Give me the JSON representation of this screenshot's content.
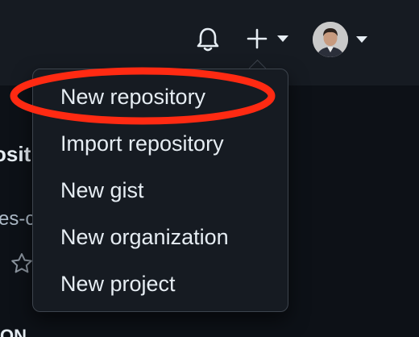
{
  "header": {
    "notifications_icon": "bell-icon",
    "create_icon": "plus-icon",
    "avatar_alt": "user avatar"
  },
  "background": {
    "repo_fragment": "osit",
    "desc_fragment": "es-c",
    "star_icon": "star-icon",
    "bottom_fragment": "ON"
  },
  "menu": {
    "items": [
      {
        "label": "New repository"
      },
      {
        "label": "Import repository"
      },
      {
        "label": "New gist"
      },
      {
        "label": "New organization"
      },
      {
        "label": "New project"
      }
    ]
  },
  "colors": {
    "header_bg": "#161b22",
    "page_bg": "#0d1117",
    "menu_bg": "#161b22",
    "text": "#e6edf3",
    "highlight": "#ff2a12"
  }
}
